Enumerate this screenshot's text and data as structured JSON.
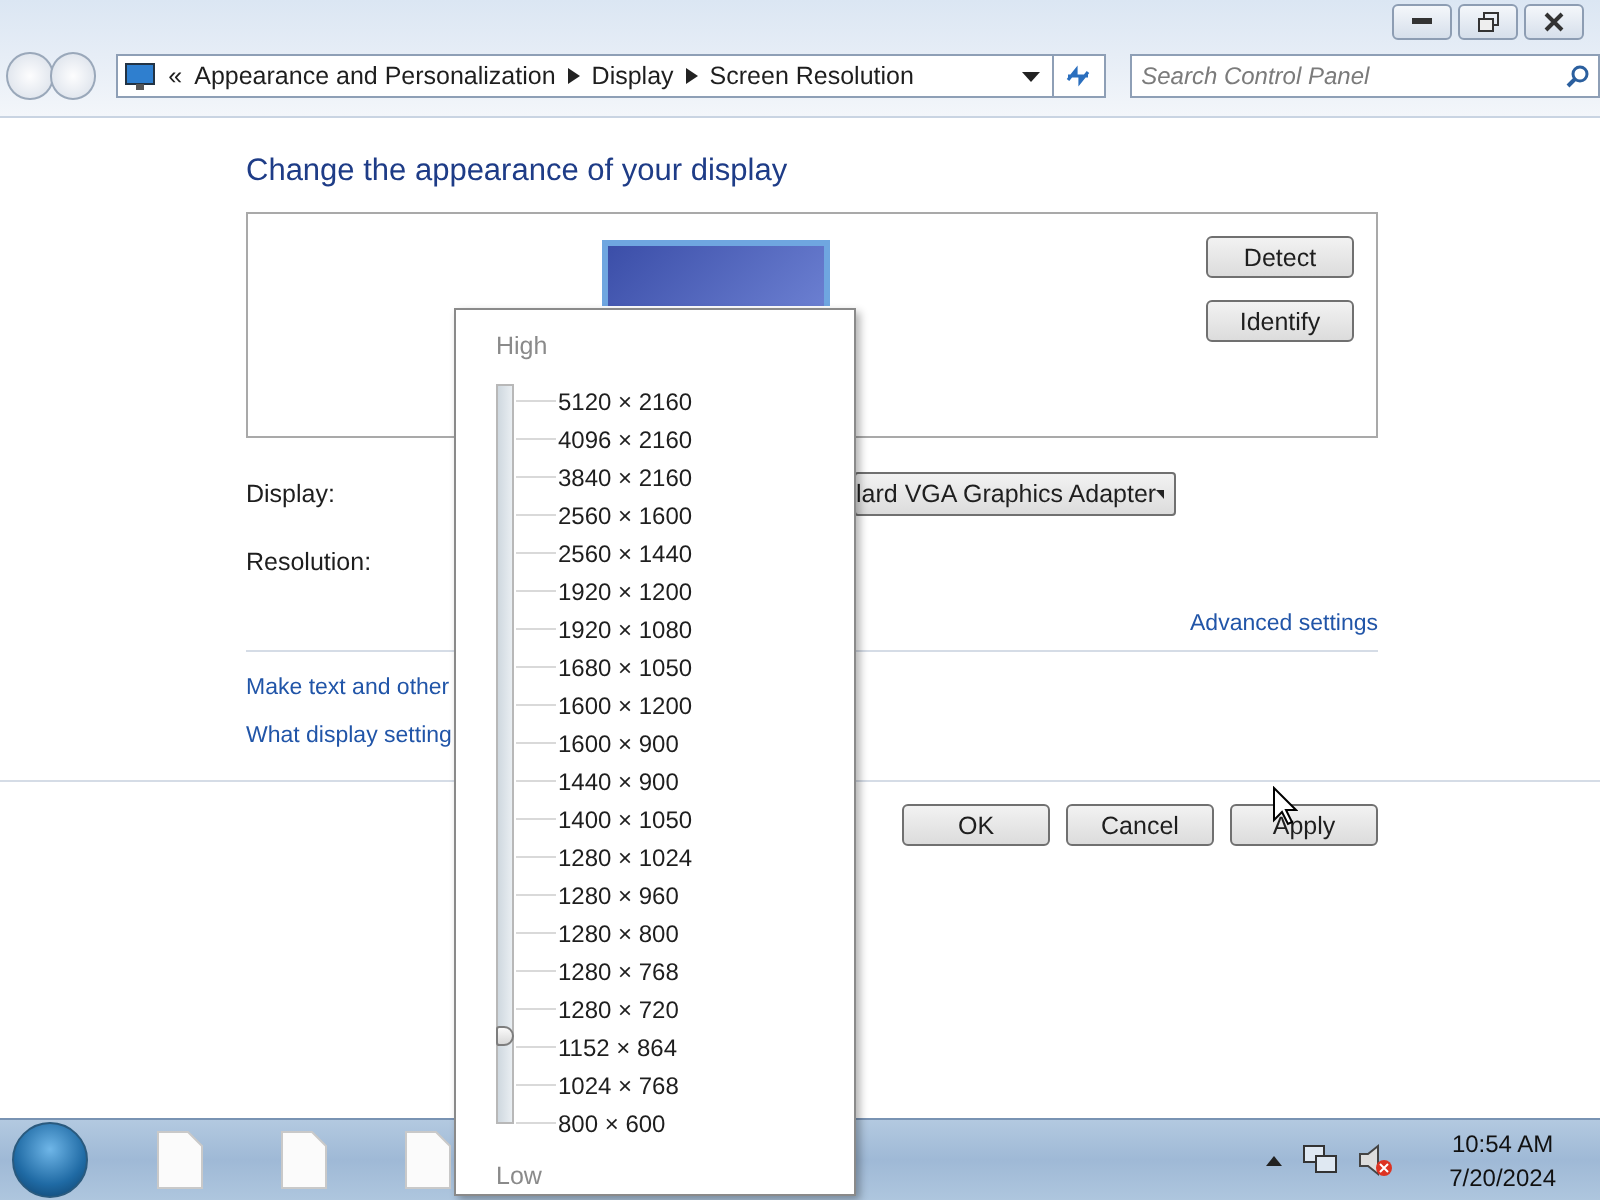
{
  "address_bar": {
    "overflow": "«",
    "crumbs": [
      "Appearance and Personalization",
      "Display",
      "Screen Resolution"
    ]
  },
  "search": {
    "placeholder": "Search Control Panel"
  },
  "heading": "Change the appearance of your display",
  "preview_buttons": [
    "Detect",
    "Identify"
  ],
  "fields": [
    {
      "label": "Display:",
      "value": "lard VGA Graphics Adapter"
    },
    {
      "label": "Resolution:"
    }
  ],
  "advanced_link": "Advanced settings",
  "links": [
    "Make text and other",
    "What display setting"
  ],
  "buttons": [
    "OK",
    "Cancel",
    "Apply"
  ],
  "resolution_popup": {
    "high_label": "High",
    "low_label": "Low",
    "level": 0.105,
    "options": [
      "5120 × 2160",
      "4096 × 2160",
      "3840 × 2160",
      "2560 × 1600",
      "2560 × 1440",
      "1920 × 1200",
      "1920 × 1080",
      "1680 × 1050",
      "1600 × 1200",
      "1600 × 900",
      "1440 × 900",
      "1400 × 1050",
      "1280 × 1024",
      "1280 × 960",
      "1280 × 800",
      "1280 × 768",
      "1280 × 720",
      "1152 × 864",
      "1024 × 768",
      "800 × 600"
    ]
  },
  "taskbar": {
    "time": "10:54 AM",
    "date": "7/20/2024"
  }
}
